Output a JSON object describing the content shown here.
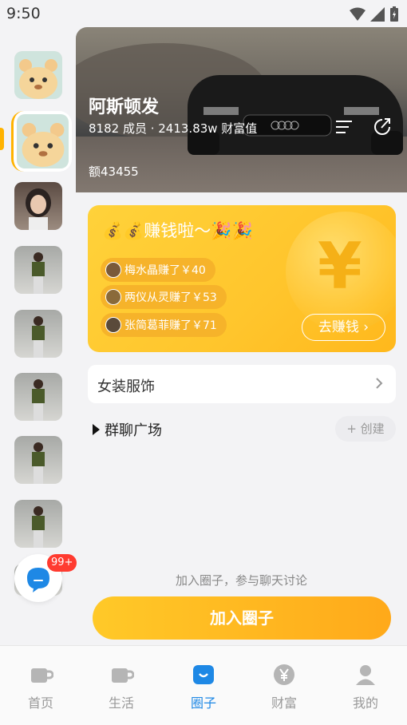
{
  "status": {
    "time": "9:50"
  },
  "hero": {
    "title": "阿斯顿发",
    "meta": "8182 成员 · 2413.83w 财富值",
    "extra": "额43455"
  },
  "earn": {
    "title": "💰💰赚钱啦～🎉🎉",
    "items": [
      {
        "text": "梅水晶赚了￥40"
      },
      {
        "text": "两仪从灵赚了￥53"
      },
      {
        "text": "张简葛菲赚了￥71"
      }
    ],
    "go_label": "去赚钱 ›"
  },
  "category": {
    "label": "女装服饰"
  },
  "plaza": {
    "label": "群聊广场",
    "create_label": "+ 创建"
  },
  "join": {
    "hint": "加入圈子，参与聊天讨论",
    "button": "加入圈子"
  },
  "badge": "99+",
  "tabs": [
    {
      "label": "首页",
      "active": false
    },
    {
      "label": "生活",
      "active": false
    },
    {
      "label": "圈子",
      "active": true
    },
    {
      "label": "财富",
      "active": false
    },
    {
      "label": "我的",
      "active": false
    }
  ],
  "colors": {
    "accent": "#ffb300",
    "tab_active": "#1e88e5"
  }
}
